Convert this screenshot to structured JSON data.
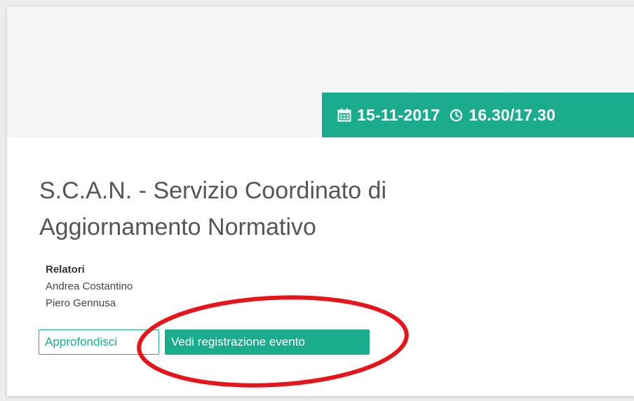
{
  "event": {
    "date": "15-11-2017",
    "time": "16.30/17.30",
    "title": "S.C.A.N. - Servizio Coordinato di Aggiornamento Normativo",
    "speakers_label": "Relatori",
    "speakers": [
      "Andrea Costantino",
      "Piero Gennusa"
    ]
  },
  "actions": {
    "learn_more_label": "Approfondisci",
    "watch_recording_label": "Vedi registrazione evento"
  },
  "icons": {
    "date": "calendar-icon",
    "time": "clock-icon"
  },
  "colors": {
    "accent": "#1aac8c",
    "annotation": "#e8141b",
    "header_bg": "#f5f5f5",
    "title_text": "#555555"
  }
}
